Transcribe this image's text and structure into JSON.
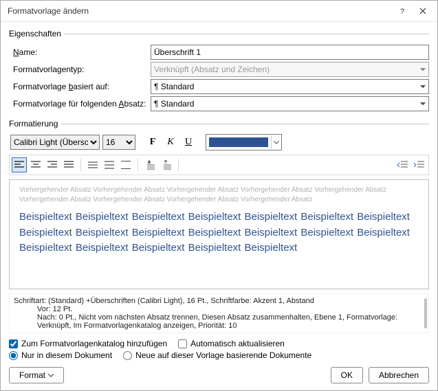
{
  "title": "Formatvorlage ändern",
  "properties": {
    "legend": "Eigenschaften",
    "name_label": "Name:",
    "name_value": "Überschrift 1",
    "type_label": "Formatvorlagentyp:",
    "type_value": "Verknüpft (Absatz und Zeichen)",
    "based_on_label": "Formatvorlage basiert auf:",
    "based_on_value": "Standard",
    "next_label": "Formatvorlage für folgenden Absatz:",
    "next_value": "Standard"
  },
  "formatting": {
    "legend": "Formatierung",
    "font_name": "Calibri Light (Überschriften)",
    "font_size": "16",
    "bold": "F",
    "italic": "K",
    "underline": "U",
    "color": "#2e5395"
  },
  "preview": {
    "prev_text": "Vorhergehender Absatz Vorhergehender Absatz Vorhergehender Absatz Vorhergehender Absatz Vorhergehender Absatz Vorhergehender Absatz Vorhergehender Absatz Vorhergehender Absatz Vorhergehender Absatz",
    "sample_text": "Beispieltext Beispieltext Beispieltext Beispieltext Beispieltext Beispieltext Beispieltext Beispieltext Beispieltext Beispieltext Beispieltext Beispieltext Beispieltext Beispieltext Beispieltext Beispieltext Beispieltext Beispieltext Beispieltext"
  },
  "description": {
    "line1": "Schriftart: (Standard) +Überschriften (Calibri Light), 16 Pt., Schriftfarbe: Akzent 1, Abstand",
    "line2": "Vor:  12 Pt.",
    "line3": "Nach:  0 Pt., Nicht vom nächsten Absatz trennen, Diesen Absatz zusammenhalten, Ebene 1, Formatvorlage: Verknüpft, Im Formatvorlagenkatalog anzeigen, Priorität: 10"
  },
  "checks": {
    "add_catalog": "Zum Formatvorlagenkatalog hinzufügen",
    "auto_update": "Automatisch aktualisieren",
    "only_doc": "Nur in diesem Dokument",
    "new_based": "Neue auf dieser Vorlage basierende Dokumente"
  },
  "footer": {
    "format": "Format",
    "ok": "OK",
    "cancel": "Abbrechen"
  }
}
